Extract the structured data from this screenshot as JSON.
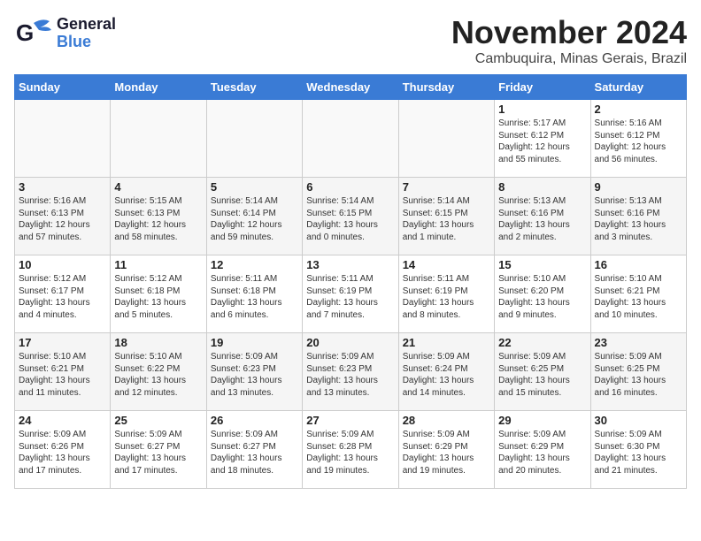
{
  "header": {
    "logo_general": "General",
    "logo_blue": "Blue",
    "month": "November 2024",
    "location": "Cambuquira, Minas Gerais, Brazil"
  },
  "days_of_week": [
    "Sunday",
    "Monday",
    "Tuesday",
    "Wednesday",
    "Thursday",
    "Friday",
    "Saturday"
  ],
  "weeks": [
    [
      {
        "day": "",
        "info": ""
      },
      {
        "day": "",
        "info": ""
      },
      {
        "day": "",
        "info": ""
      },
      {
        "day": "",
        "info": ""
      },
      {
        "day": "",
        "info": ""
      },
      {
        "day": "1",
        "info": "Sunrise: 5:17 AM\nSunset: 6:12 PM\nDaylight: 12 hours and 55 minutes."
      },
      {
        "day": "2",
        "info": "Sunrise: 5:16 AM\nSunset: 6:12 PM\nDaylight: 12 hours and 56 minutes."
      }
    ],
    [
      {
        "day": "3",
        "info": "Sunrise: 5:16 AM\nSunset: 6:13 PM\nDaylight: 12 hours and 57 minutes."
      },
      {
        "day": "4",
        "info": "Sunrise: 5:15 AM\nSunset: 6:13 PM\nDaylight: 12 hours and 58 minutes."
      },
      {
        "day": "5",
        "info": "Sunrise: 5:14 AM\nSunset: 6:14 PM\nDaylight: 12 hours and 59 minutes."
      },
      {
        "day": "6",
        "info": "Sunrise: 5:14 AM\nSunset: 6:15 PM\nDaylight: 13 hours and 0 minutes."
      },
      {
        "day": "7",
        "info": "Sunrise: 5:14 AM\nSunset: 6:15 PM\nDaylight: 13 hours and 1 minute."
      },
      {
        "day": "8",
        "info": "Sunrise: 5:13 AM\nSunset: 6:16 PM\nDaylight: 13 hours and 2 minutes."
      },
      {
        "day": "9",
        "info": "Sunrise: 5:13 AM\nSunset: 6:16 PM\nDaylight: 13 hours and 3 minutes."
      }
    ],
    [
      {
        "day": "10",
        "info": "Sunrise: 5:12 AM\nSunset: 6:17 PM\nDaylight: 13 hours and 4 minutes."
      },
      {
        "day": "11",
        "info": "Sunrise: 5:12 AM\nSunset: 6:18 PM\nDaylight: 13 hours and 5 minutes."
      },
      {
        "day": "12",
        "info": "Sunrise: 5:11 AM\nSunset: 6:18 PM\nDaylight: 13 hours and 6 minutes."
      },
      {
        "day": "13",
        "info": "Sunrise: 5:11 AM\nSunset: 6:19 PM\nDaylight: 13 hours and 7 minutes."
      },
      {
        "day": "14",
        "info": "Sunrise: 5:11 AM\nSunset: 6:19 PM\nDaylight: 13 hours and 8 minutes."
      },
      {
        "day": "15",
        "info": "Sunrise: 5:10 AM\nSunset: 6:20 PM\nDaylight: 13 hours and 9 minutes."
      },
      {
        "day": "16",
        "info": "Sunrise: 5:10 AM\nSunset: 6:21 PM\nDaylight: 13 hours and 10 minutes."
      }
    ],
    [
      {
        "day": "17",
        "info": "Sunrise: 5:10 AM\nSunset: 6:21 PM\nDaylight: 13 hours and 11 minutes."
      },
      {
        "day": "18",
        "info": "Sunrise: 5:10 AM\nSunset: 6:22 PM\nDaylight: 13 hours and 12 minutes."
      },
      {
        "day": "19",
        "info": "Sunrise: 5:09 AM\nSunset: 6:23 PM\nDaylight: 13 hours and 13 minutes."
      },
      {
        "day": "20",
        "info": "Sunrise: 5:09 AM\nSunset: 6:23 PM\nDaylight: 13 hours and 13 minutes."
      },
      {
        "day": "21",
        "info": "Sunrise: 5:09 AM\nSunset: 6:24 PM\nDaylight: 13 hours and 14 minutes."
      },
      {
        "day": "22",
        "info": "Sunrise: 5:09 AM\nSunset: 6:25 PM\nDaylight: 13 hours and 15 minutes."
      },
      {
        "day": "23",
        "info": "Sunrise: 5:09 AM\nSunset: 6:25 PM\nDaylight: 13 hours and 16 minutes."
      }
    ],
    [
      {
        "day": "24",
        "info": "Sunrise: 5:09 AM\nSunset: 6:26 PM\nDaylight: 13 hours and 17 minutes."
      },
      {
        "day": "25",
        "info": "Sunrise: 5:09 AM\nSunset: 6:27 PM\nDaylight: 13 hours and 17 minutes."
      },
      {
        "day": "26",
        "info": "Sunrise: 5:09 AM\nSunset: 6:27 PM\nDaylight: 13 hours and 18 minutes."
      },
      {
        "day": "27",
        "info": "Sunrise: 5:09 AM\nSunset: 6:28 PM\nDaylight: 13 hours and 19 minutes."
      },
      {
        "day": "28",
        "info": "Sunrise: 5:09 AM\nSunset: 6:29 PM\nDaylight: 13 hours and 19 minutes."
      },
      {
        "day": "29",
        "info": "Sunrise: 5:09 AM\nSunset: 6:29 PM\nDaylight: 13 hours and 20 minutes."
      },
      {
        "day": "30",
        "info": "Sunrise: 5:09 AM\nSunset: 6:30 PM\nDaylight: 13 hours and 21 minutes."
      }
    ]
  ]
}
